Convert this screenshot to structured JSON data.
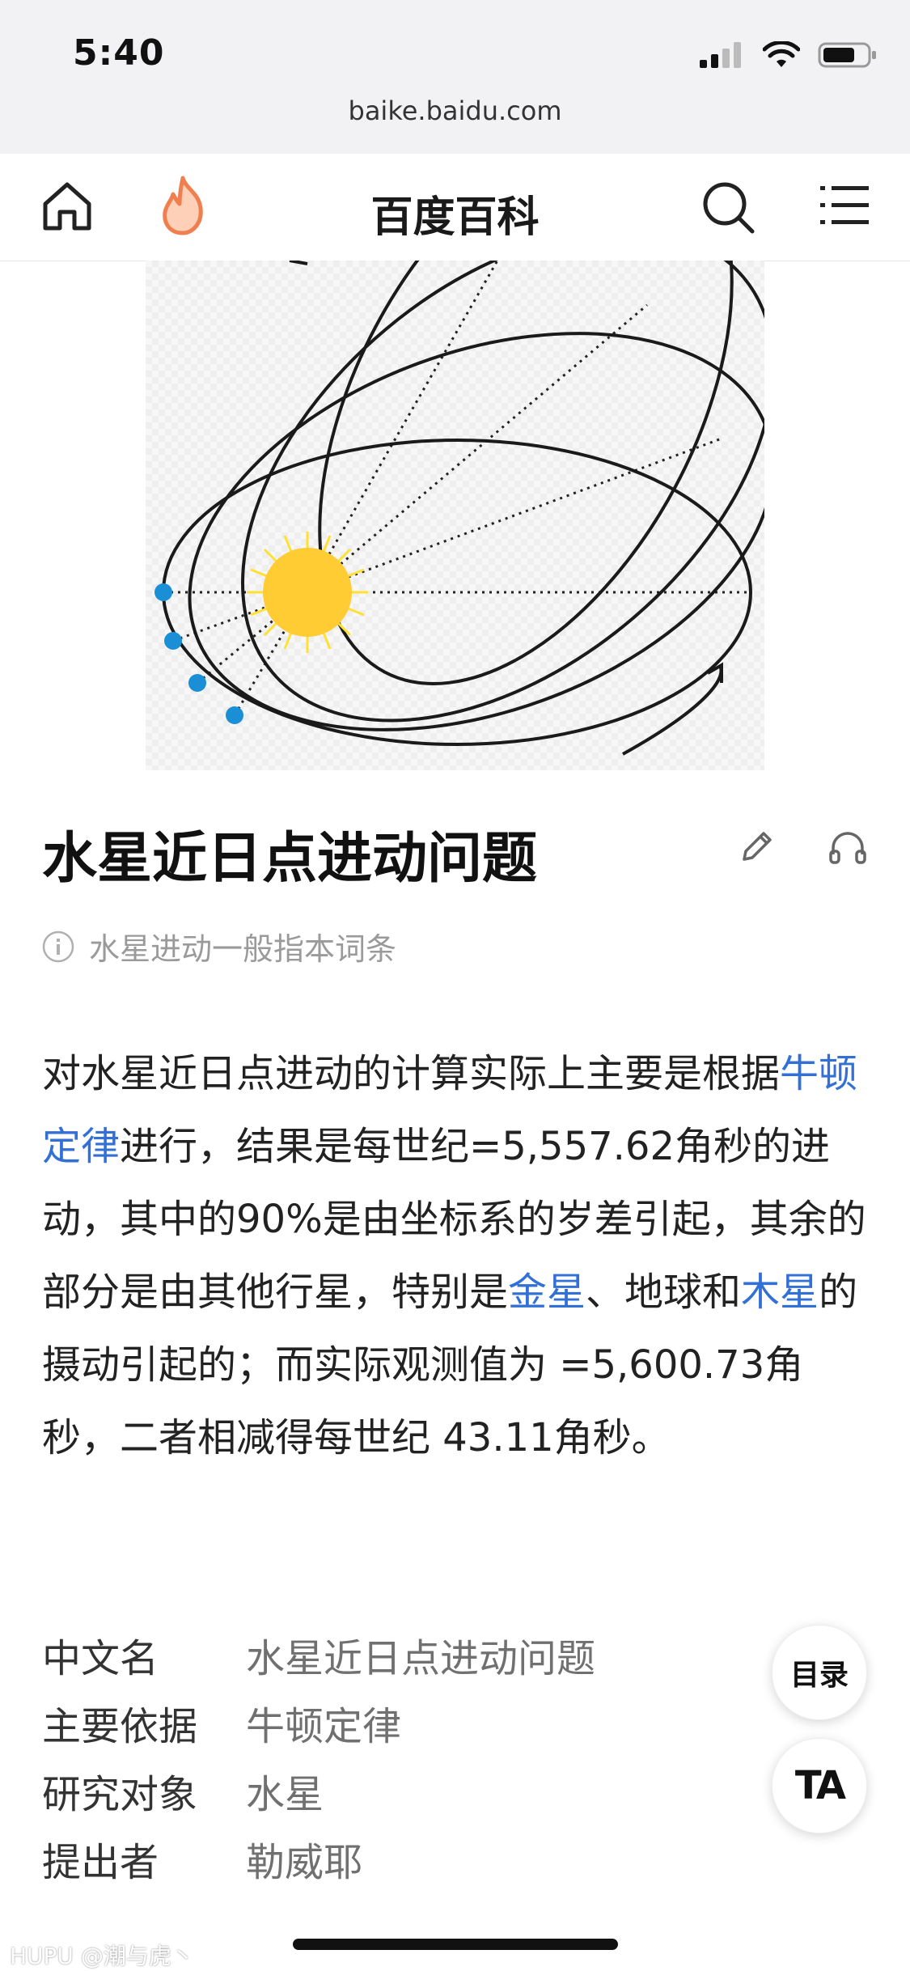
{
  "status_bar": {
    "time": "5:40"
  },
  "browser": {
    "url": "baike.baidu.com"
  },
  "nav": {
    "title": "百度百科",
    "home_icon": "home-icon",
    "hot_icon": "flame-icon",
    "search_icon": "search-icon",
    "menu_icon": "menu-icon"
  },
  "article": {
    "title": "水星近日点进动问题",
    "disambiguation": "水星进动一般指本词条",
    "paragraph": {
      "p1": "对水星近日点进动的计算实际上主要是根据",
      "link1": "牛顿定律",
      "p2": "进行，结果是每世纪=5,557.62角秒的进动，其中的90%是由坐标系的岁差引起，其余的部分是由其他行星，特别是",
      "link2": "金星",
      "p3": "、地球和",
      "link3": "木星",
      "p4": "的摄动引起的；而实际观测值为 =5,600.73角秒，二者相减得每世纪 43.11角秒。"
    },
    "infobox": [
      {
        "key": "中文名",
        "value": "水星近日点进动问题"
      },
      {
        "key": "主要依据",
        "value": "牛顿定律"
      },
      {
        "key": "研究对象",
        "value": "水星"
      },
      {
        "key": "提出者",
        "value": "勒威耶"
      }
    ]
  },
  "floating": {
    "toc_label": "目录",
    "font_label": "TA"
  },
  "watermark": "HUPU @潮与虎丶",
  "colors": {
    "link": "#3370d6",
    "sun": "#ffcc33",
    "planet_dot": "#1a8fd6"
  }
}
